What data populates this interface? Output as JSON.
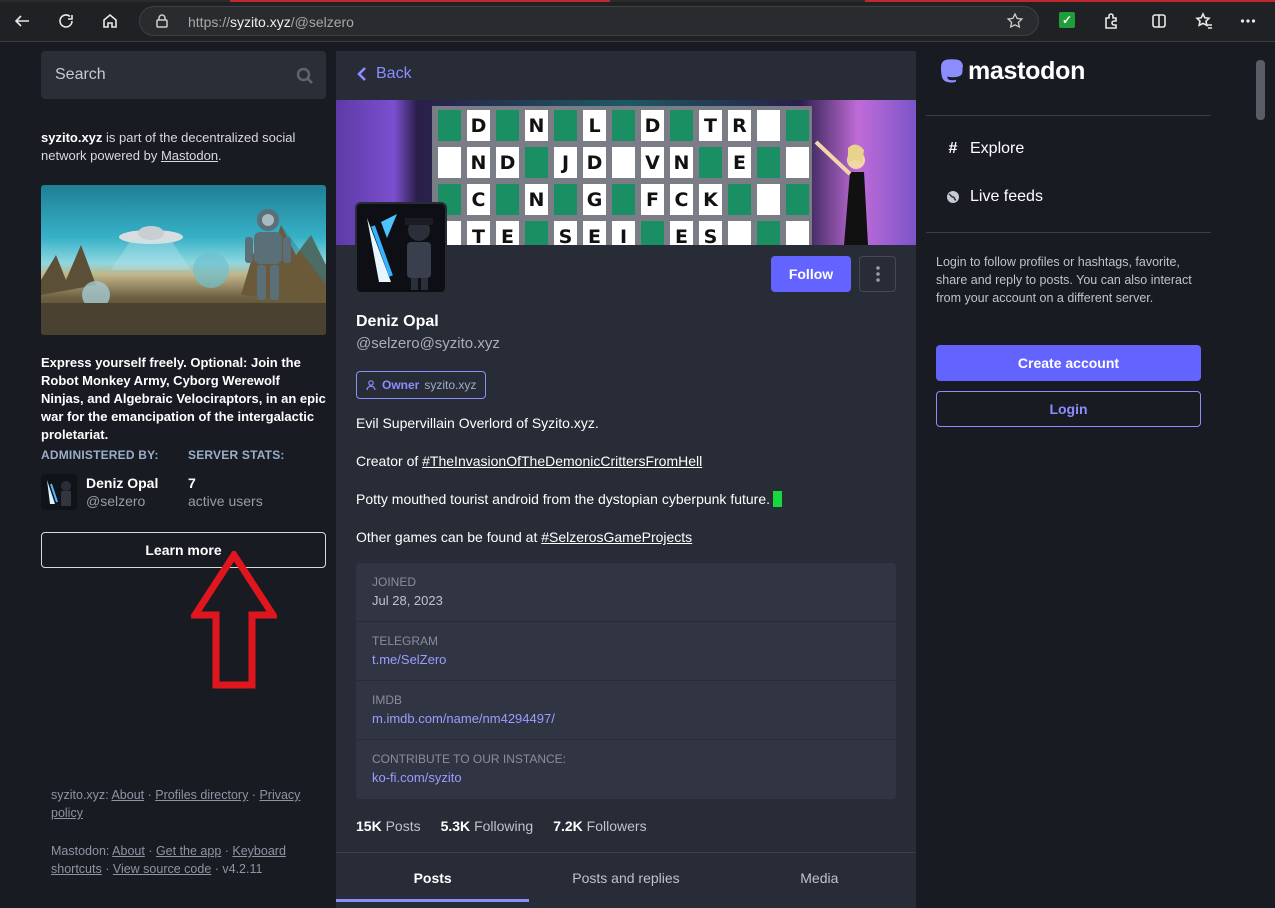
{
  "browser": {
    "url_prefix": "https://",
    "url_host": "syzito.xyz",
    "url_path": "/@selzero"
  },
  "left": {
    "search_placeholder": "Search",
    "server_name": "syzito.xyz",
    "server_desc_mid": " is part of the decentralized social network powered by ",
    "server_desc_link": "Mastodon",
    "server_desc_end": ".",
    "tagline": "Express yourself freely. Optional: Join the Robot Monkey Army, Cyborg Werewolf Ninjas, and Algebraic Velociraptors, in an epic war for the emancipation of the intergalactic proletariat.",
    "administered_by_label": "ADMINISTERED BY:",
    "server_stats_label": "SERVER STATS:",
    "admin_name": "Deniz Opal",
    "admin_handle": "@selzero",
    "active_users_count": "7",
    "active_users_label": "active users",
    "learn_more": "Learn more",
    "footer": {
      "server": "syzito.xyz",
      "about": "About",
      "profiles_directory": "Profiles directory",
      "privacy_policy": "Privacy policy",
      "mastodon": "Mastodon",
      "about2": "About",
      "get_the_app": "Get the app",
      "keyboard_shortcuts": "Keyboard shortcuts",
      "view_source": "View source code",
      "version": "v4.2.11"
    }
  },
  "profile": {
    "back": "Back",
    "follow": "Follow",
    "name": "Deniz Opal",
    "handle": "@selzero@syzito.xyz",
    "badge_role": "Owner",
    "badge_server": "syzito.xyz",
    "bio_1": "Evil Supervillain Overlord of Syzito.xyz.",
    "bio_2_prefix": "Creator of ",
    "bio_2_tag": "#TheInvasionOfTheDemonicCrittersFromHell",
    "bio_3": "Potty mouthed tourist android from the dystopian cyberpunk future.",
    "bio_4_prefix": "Other games can be found at ",
    "bio_4_tag": "#SelzerosGameProjects",
    "fields": [
      {
        "label": "JOINED",
        "value": "Jul 28, 2023"
      },
      {
        "label": "TELEGRAM",
        "value": "t.me/SelZero"
      },
      {
        "label": "IMDB",
        "value": "m.imdb.com/name/nm4294497/"
      },
      {
        "label": "CONTRIBUTE TO OUR INSTANCE:",
        "value": "ko-fi.com/syzito"
      }
    ],
    "posts_count": "15K",
    "posts_label": "Posts",
    "following_count": "5.3K",
    "following_label": "Following",
    "followers_count": "7.2K",
    "followers_label": "Followers",
    "tabs": [
      "Posts",
      "Posts and replies",
      "Media"
    ],
    "puzzle_rows": [
      "D N L D T R",
      "N D J D V N E",
      "C N G F C K",
      "T E S E I E S"
    ]
  },
  "right": {
    "logo_text": "mastodon",
    "explore": "Explore",
    "live_feeds": "Live feeds",
    "login_text": "Login to follow profiles or hashtags, favorite, share and reply to posts. You can also interact from your account on a different server.",
    "create_account": "Create account",
    "login": "Login"
  },
  "colors": {
    "accent": "#6364ff",
    "link": "#8c8dff",
    "annotation_arrow": "#e0161e"
  }
}
